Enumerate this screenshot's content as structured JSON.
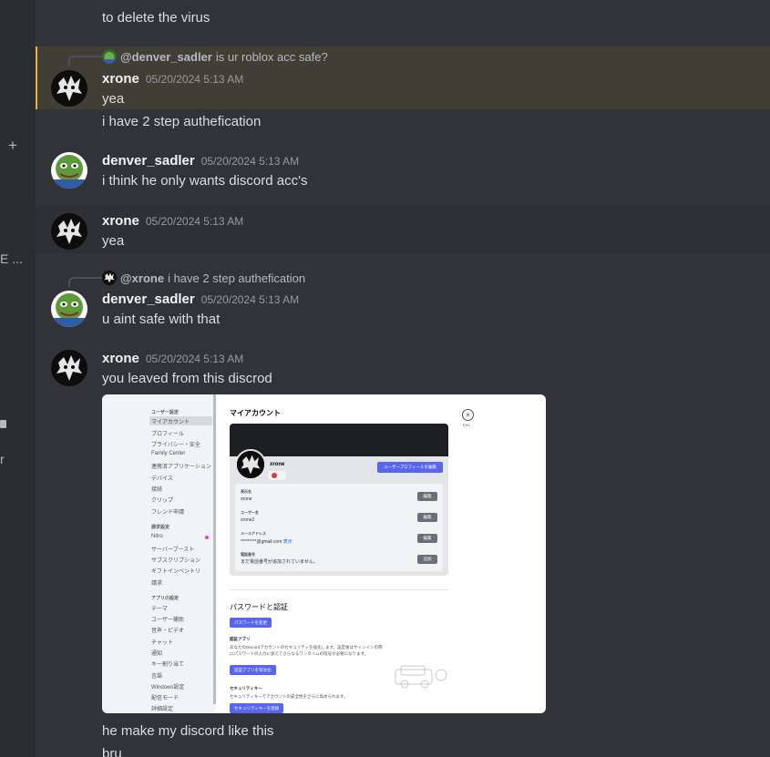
{
  "sidebar": {
    "plus_symbol": "+",
    "truncated_text_1": "E ...",
    "truncated_text_2": "r"
  },
  "messages": [
    {
      "text": "to delete the virus"
    },
    {
      "reply": {
        "mention": "@denver_sadler",
        "text": "is ur roblox acc safe?"
      },
      "author": "xrone",
      "timestamp": "05/20/2024 5:13 AM",
      "lines": [
        "yea",
        "i have 2 step authefication"
      ]
    },
    {
      "author": "denver_sadler",
      "timestamp": "05/20/2024 5:13 AM",
      "lines": [
        "i think he only wants discord acc's"
      ]
    },
    {
      "author": "xrone",
      "timestamp": "05/20/2024 5:13 AM",
      "lines": [
        "yea"
      ]
    },
    {
      "reply": {
        "mention": "@xrone",
        "text": "i have 2 step authefication"
      },
      "author": "denver_sadler",
      "timestamp": "05/20/2024 5:13 AM",
      "lines": [
        "u aint safe with that"
      ]
    },
    {
      "author": "xrone",
      "timestamp": "05/20/2024 5:13 AM",
      "lines": [
        "you leaved from this discrod",
        "he make my discord like this",
        "bru"
      ]
    }
  ],
  "attachment": {
    "sidebar": {
      "section1": "ユーザー設定",
      "items1": [
        "マイアカウント",
        "プロフィール",
        "プライバシー・安全",
        "Family Center",
        "連携済アプリケーション",
        "デバイス",
        "接続",
        "クリップ",
        "フレンド申請"
      ],
      "section2": "請求設定",
      "items2": [
        "Nitro",
        "サーバーブースト",
        "サブスクリプション",
        "ギフトインベントリ",
        "請求"
      ],
      "section3": "アプリの設定",
      "items3": [
        "テーマ",
        "ユーザー補助",
        "音声・ビデオ",
        "チャット",
        "通知",
        "キー割り当て",
        "言語",
        "Windows設定",
        "配信モード",
        "詳細設定"
      ]
    },
    "title": "マイアカウント",
    "close_symbol": "×",
    "esc": "ESC",
    "profile": {
      "username": "xrone",
      "edit_profile_button": "ユーザープロフィールを編集",
      "fields": [
        {
          "label": "表示名",
          "value": "xrone",
          "button": "編集"
        },
        {
          "label": "ユーザー名",
          "value": "xrone2",
          "button": "編集"
        },
        {
          "label": "メールアドレス",
          "value": "*********@gmail.com",
          "link": "表示",
          "button": "編集"
        },
        {
          "label": "電話番号",
          "value": "まだ電話番号が追加されていません。",
          "button": "追加"
        }
      ]
    },
    "password_section": {
      "heading": "パスワードと認証",
      "change_password_button": "パスワードを変更",
      "auth_app_heading": "認証アプリ",
      "auth_app_desc_1": "あなたのDiscordアカウントのセキュリティを強化します。設定後はサインインの際",
      "auth_app_desc_2": "にパスワードの入力に加えてさらなるワンタイムの暗号が必要になります。",
      "enable_auth_button": "認証アプリを有効化",
      "security_key_heading": "セキュリティキー",
      "security_key_desc": "セキュリティキーでアカウントの安全性をさらに高められます。",
      "register_key_button": "セキュリティキーを登録"
    }
  },
  "colors": {
    "background": "#313338",
    "highlight": "#413e35",
    "highlight_bar": "#f0b232",
    "username": "#f2f3f5",
    "timestamp": "#949ba4",
    "blurple": "#5865f2"
  }
}
